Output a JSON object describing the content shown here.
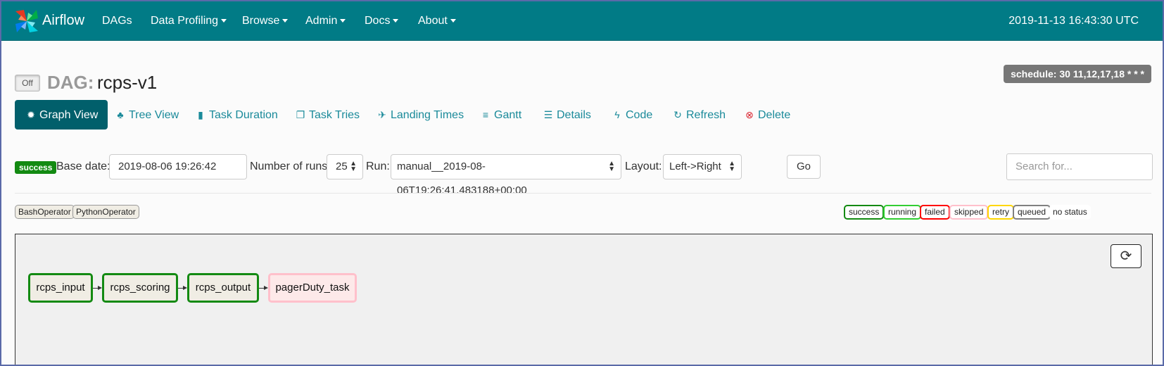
{
  "nav": {
    "brand": "Airflow",
    "items": [
      {
        "label": "DAGs",
        "dropdown": false
      },
      {
        "label": "Data Profiling",
        "dropdown": true
      },
      {
        "label": "Browse",
        "dropdown": true
      },
      {
        "label": "Admin",
        "dropdown": true
      },
      {
        "label": "Docs",
        "dropdown": true
      },
      {
        "label": "About",
        "dropdown": true
      }
    ],
    "timestamp": "2019-11-13 16:43:30 UTC"
  },
  "dag": {
    "toggle_label": "Off",
    "prefix": "DAG:",
    "name": "rcps-v1",
    "schedule": "schedule: 30 11,12,17,18 * * *"
  },
  "tabs": [
    {
      "label": "Graph View",
      "icon": "cog-icon",
      "active": true
    },
    {
      "label": "Tree View",
      "icon": "tree-icon"
    },
    {
      "label": "Task Duration",
      "icon": "bar-chart-icon"
    },
    {
      "label": "Task Tries",
      "icon": "duplicate-icon"
    },
    {
      "label": "Landing Times",
      "icon": "plane-icon"
    },
    {
      "label": "Gantt",
      "icon": "align-left-icon"
    },
    {
      "label": "Details",
      "icon": "list-icon"
    },
    {
      "label": "Code",
      "icon": "flash-icon"
    },
    {
      "label": "Refresh",
      "icon": "refresh-icon"
    },
    {
      "label": "Delete",
      "icon": "remove-circle-icon"
    }
  ],
  "form": {
    "status_badge": "success",
    "base_date_label": "Base date:",
    "base_date_value": "2019-08-06 19:26:42",
    "num_runs_label": "Number of runs:",
    "num_runs_value": "25",
    "run_label": "Run:",
    "run_value": "manual__2019-08-06T19:26:41.483188+00:00",
    "layout_label": "Layout:",
    "layout_value": "Left->Right",
    "go_label": "Go",
    "search_placeholder": "Search for..."
  },
  "operators": [
    "BashOperator",
    "PythonOperator"
  ],
  "legend": [
    {
      "label": "success",
      "color": "#138a12"
    },
    {
      "label": "running",
      "color": "#32cd32"
    },
    {
      "label": "failed",
      "color": "#ff0000"
    },
    {
      "label": "skipped",
      "color": "#ffc0cb"
    },
    {
      "label": "retry",
      "color": "#ffd700"
    },
    {
      "label": "queued",
      "color": "#808080"
    },
    {
      "label": "no status",
      "color": ""
    }
  ],
  "graph": {
    "nodes": [
      {
        "label": "rcps_input",
        "state": "success"
      },
      {
        "label": "rcps_scoring",
        "state": "success"
      },
      {
        "label": "rcps_output",
        "state": "success"
      },
      {
        "label": "pagerDuty_task",
        "state": "skipped"
      }
    ]
  },
  "colors": {
    "navbar": "#017b86",
    "accent": "#1a8a9a",
    "success": "#138a12"
  }
}
